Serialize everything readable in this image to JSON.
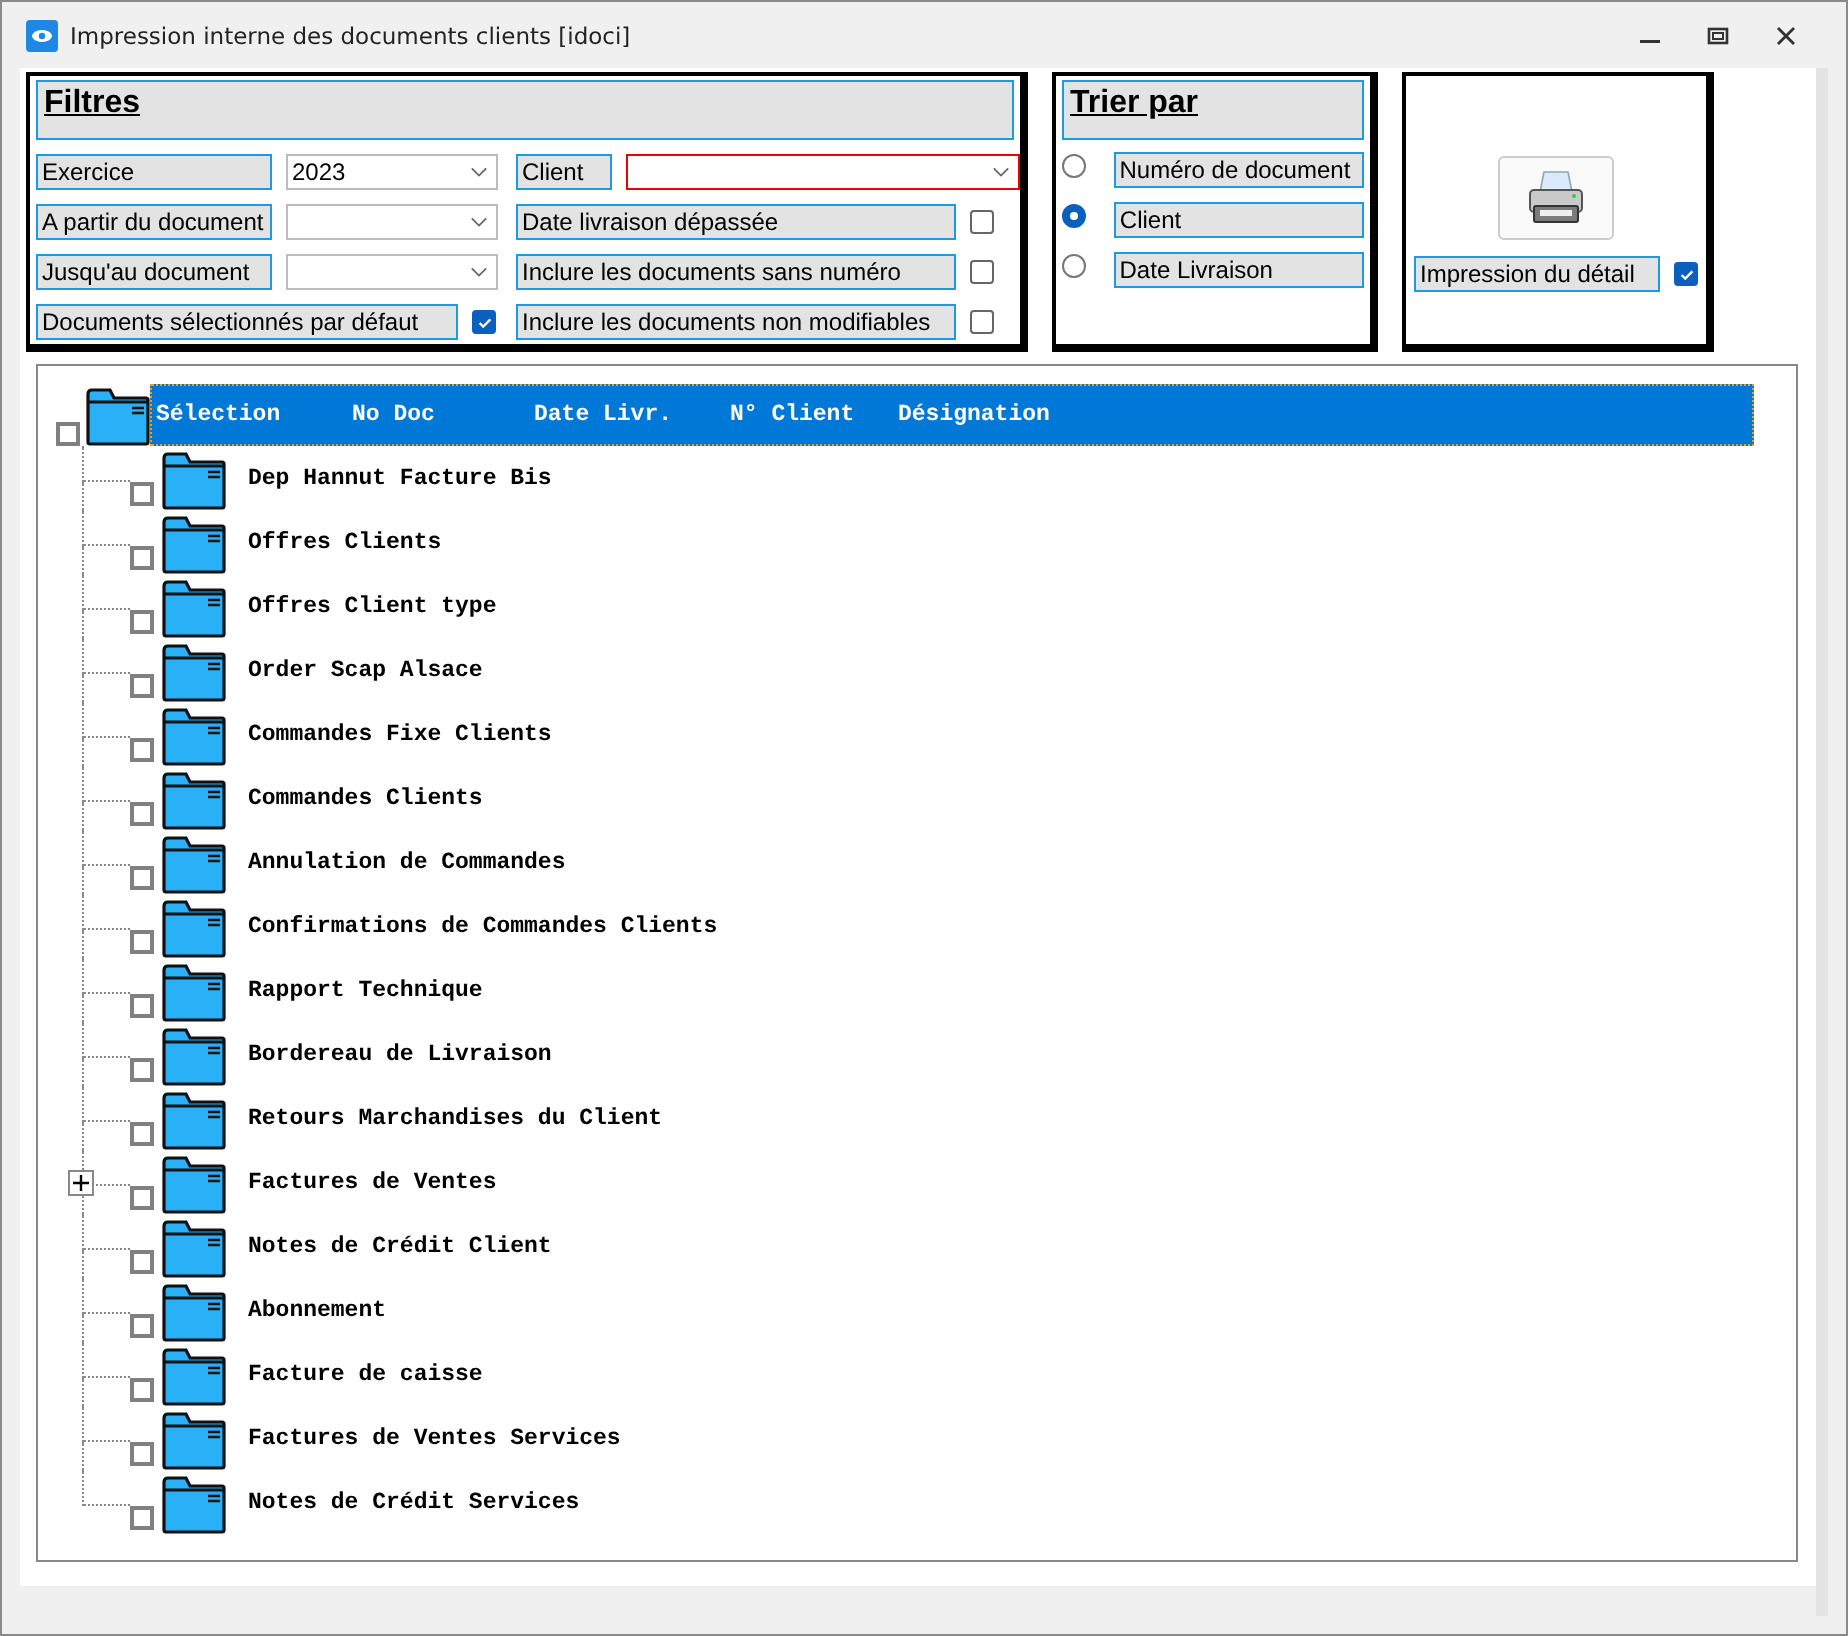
{
  "window": {
    "title": "Impression interne des documents clients [idoci]"
  },
  "filters": {
    "title": "Filtres",
    "items": [
      {
        "kind": "combo",
        "label": "Exercice",
        "value": "2023",
        "invalid": false
      },
      {
        "kind": "combo",
        "label": "Client",
        "invalid": true
      },
      {
        "kind": "combo",
        "label": "A partir du document",
        "invalid": false
      },
      {
        "kind": "check",
        "label": "Date livraison dépassée",
        "checked": false
      },
      {
        "kind": "combo",
        "label": "Jusqu'au document",
        "invalid": false
      },
      {
        "kind": "check",
        "label": "Inclure les documents sans numéro",
        "checked": false
      },
      {
        "kind": "check",
        "label": "Documents sélectionnés par défaut",
        "checked": true
      },
      {
        "kind": "check",
        "label": "Inclure les documents non modifiables",
        "checked": false
      }
    ]
  },
  "sort": {
    "title": "Trier par",
    "options": [
      {
        "label": "Numéro de document",
        "selected": false
      },
      {
        "label": "Client",
        "selected": true
      },
      {
        "label": "Date Livraison",
        "selected": false
      }
    ]
  },
  "print": {
    "label": "Impression du détail",
    "checked": true
  },
  "tree": {
    "root": {
      "checked": false,
      "selected": true,
      "columns": [
        "Sélection",
        "No Doc",
        "Date Livr.",
        "N° Client",
        "Désignation"
      ],
      "children": [
        {
          "label": "Dep Hannut Facture Bis",
          "checked": false,
          "collapsed": false
        },
        {
          "label": "Offres Clients",
          "checked": false,
          "collapsed": false
        },
        {
          "label": "Offres Client type",
          "checked": false,
          "collapsed": false
        },
        {
          "label": "Order Scap Alsace",
          "checked": false,
          "collapsed": false
        },
        {
          "label": "Commandes Fixe Clients",
          "checked": false,
          "collapsed": false
        },
        {
          "label": "Commandes Clients",
          "checked": false,
          "collapsed": false
        },
        {
          "label": "Annulation de Commandes",
          "checked": false,
          "collapsed": false
        },
        {
          "label": "Confirmations de Commandes Clients",
          "checked": false,
          "collapsed": false
        },
        {
          "label": "Rapport Technique",
          "checked": false,
          "collapsed": false
        },
        {
          "label": "Bordereau de Livraison",
          "checked": false,
          "collapsed": false
        },
        {
          "label": "Retours Marchandises du Client",
          "checked": false,
          "collapsed": false
        },
        {
          "label": "Factures de Ventes",
          "checked": false,
          "collapsed": true
        },
        {
          "label": "Notes de Crédit Client",
          "checked": false,
          "collapsed": false
        },
        {
          "label": "Abonnement",
          "checked": false,
          "collapsed": false
        },
        {
          "label": "Facture de caisse",
          "checked": false,
          "collapsed": false
        },
        {
          "label": "Factures de Ventes Services",
          "checked": false,
          "collapsed": false
        },
        {
          "label": "Notes de Crédit Services",
          "checked": false,
          "collapsed": false
        }
      ]
    }
  }
}
